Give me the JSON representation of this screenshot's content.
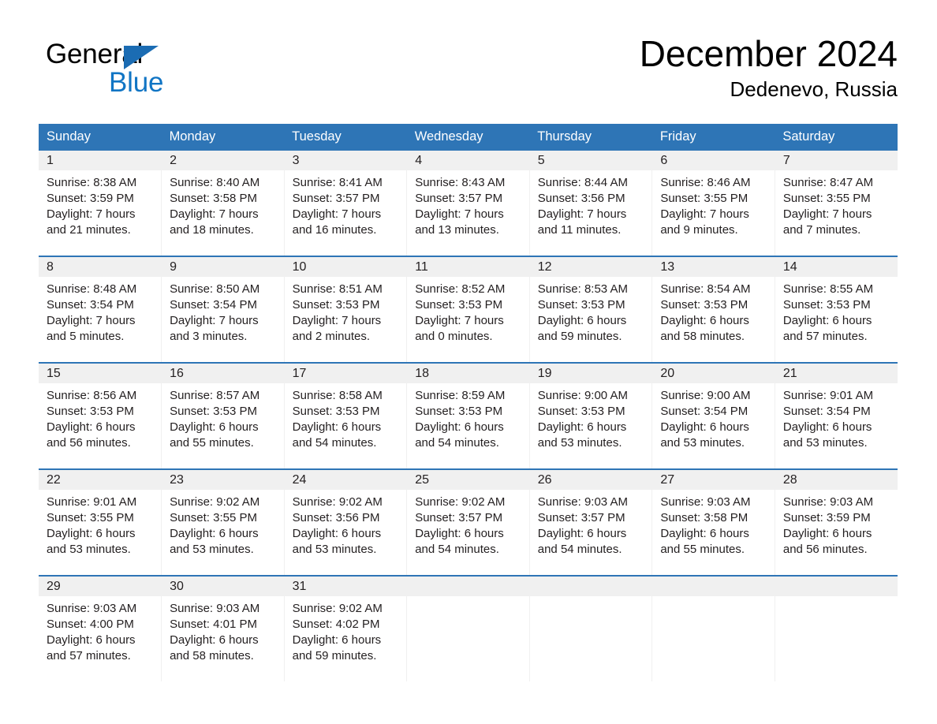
{
  "brand": {
    "name_part1": "General",
    "name_part2": "Blue",
    "triangle_color": "#1b6cb3",
    "blue_text_color": "#1175c4"
  },
  "header": {
    "month_title": "December 2024",
    "location": "Dedenevo, Russia"
  },
  "theme": {
    "header_blue": "#2e75b6",
    "row_divider_blue": "#2e75b6",
    "daynum_band": "#f0f0f0",
    "text": "#231f20"
  },
  "weekday_headers": [
    "Sunday",
    "Monday",
    "Tuesday",
    "Wednesday",
    "Thursday",
    "Friday",
    "Saturday"
  ],
  "weeks": [
    [
      {
        "day": "1",
        "sunrise": "Sunrise: 8:38 AM",
        "sunset": "Sunset: 3:59 PM",
        "daylight_line1": "Daylight: 7 hours",
        "daylight_line2": "and 21 minutes."
      },
      {
        "day": "2",
        "sunrise": "Sunrise: 8:40 AM",
        "sunset": "Sunset: 3:58 PM",
        "daylight_line1": "Daylight: 7 hours",
        "daylight_line2": "and 18 minutes."
      },
      {
        "day": "3",
        "sunrise": "Sunrise: 8:41 AM",
        "sunset": "Sunset: 3:57 PM",
        "daylight_line1": "Daylight: 7 hours",
        "daylight_line2": "and 16 minutes."
      },
      {
        "day": "4",
        "sunrise": "Sunrise: 8:43 AM",
        "sunset": "Sunset: 3:57 PM",
        "daylight_line1": "Daylight: 7 hours",
        "daylight_line2": "and 13 minutes."
      },
      {
        "day": "5",
        "sunrise": "Sunrise: 8:44 AM",
        "sunset": "Sunset: 3:56 PM",
        "daylight_line1": "Daylight: 7 hours",
        "daylight_line2": "and 11 minutes."
      },
      {
        "day": "6",
        "sunrise": "Sunrise: 8:46 AM",
        "sunset": "Sunset: 3:55 PM",
        "daylight_line1": "Daylight: 7 hours",
        "daylight_line2": "and 9 minutes."
      },
      {
        "day": "7",
        "sunrise": "Sunrise: 8:47 AM",
        "sunset": "Sunset: 3:55 PM",
        "daylight_line1": "Daylight: 7 hours",
        "daylight_line2": "and 7 minutes."
      }
    ],
    [
      {
        "day": "8",
        "sunrise": "Sunrise: 8:48 AM",
        "sunset": "Sunset: 3:54 PM",
        "daylight_line1": "Daylight: 7 hours",
        "daylight_line2": "and 5 minutes."
      },
      {
        "day": "9",
        "sunrise": "Sunrise: 8:50 AM",
        "sunset": "Sunset: 3:54 PM",
        "daylight_line1": "Daylight: 7 hours",
        "daylight_line2": "and 3 minutes."
      },
      {
        "day": "10",
        "sunrise": "Sunrise: 8:51 AM",
        "sunset": "Sunset: 3:53 PM",
        "daylight_line1": "Daylight: 7 hours",
        "daylight_line2": "and 2 minutes."
      },
      {
        "day": "11",
        "sunrise": "Sunrise: 8:52 AM",
        "sunset": "Sunset: 3:53 PM",
        "daylight_line1": "Daylight: 7 hours",
        "daylight_line2": "and 0 minutes."
      },
      {
        "day": "12",
        "sunrise": "Sunrise: 8:53 AM",
        "sunset": "Sunset: 3:53 PM",
        "daylight_line1": "Daylight: 6 hours",
        "daylight_line2": "and 59 minutes."
      },
      {
        "day": "13",
        "sunrise": "Sunrise: 8:54 AM",
        "sunset": "Sunset: 3:53 PM",
        "daylight_line1": "Daylight: 6 hours",
        "daylight_line2": "and 58 minutes."
      },
      {
        "day": "14",
        "sunrise": "Sunrise: 8:55 AM",
        "sunset": "Sunset: 3:53 PM",
        "daylight_line1": "Daylight: 6 hours",
        "daylight_line2": "and 57 minutes."
      }
    ],
    [
      {
        "day": "15",
        "sunrise": "Sunrise: 8:56 AM",
        "sunset": "Sunset: 3:53 PM",
        "daylight_line1": "Daylight: 6 hours",
        "daylight_line2": "and 56 minutes."
      },
      {
        "day": "16",
        "sunrise": "Sunrise: 8:57 AM",
        "sunset": "Sunset: 3:53 PM",
        "daylight_line1": "Daylight: 6 hours",
        "daylight_line2": "and 55 minutes."
      },
      {
        "day": "17",
        "sunrise": "Sunrise: 8:58 AM",
        "sunset": "Sunset: 3:53 PM",
        "daylight_line1": "Daylight: 6 hours",
        "daylight_line2": "and 54 minutes."
      },
      {
        "day": "18",
        "sunrise": "Sunrise: 8:59 AM",
        "sunset": "Sunset: 3:53 PM",
        "daylight_line1": "Daylight: 6 hours",
        "daylight_line2": "and 54 minutes."
      },
      {
        "day": "19",
        "sunrise": "Sunrise: 9:00 AM",
        "sunset": "Sunset: 3:53 PM",
        "daylight_line1": "Daylight: 6 hours",
        "daylight_line2": "and 53 minutes."
      },
      {
        "day": "20",
        "sunrise": "Sunrise: 9:00 AM",
        "sunset": "Sunset: 3:54 PM",
        "daylight_line1": "Daylight: 6 hours",
        "daylight_line2": "and 53 minutes."
      },
      {
        "day": "21",
        "sunrise": "Sunrise: 9:01 AM",
        "sunset": "Sunset: 3:54 PM",
        "daylight_line1": "Daylight: 6 hours",
        "daylight_line2": "and 53 minutes."
      }
    ],
    [
      {
        "day": "22",
        "sunrise": "Sunrise: 9:01 AM",
        "sunset": "Sunset: 3:55 PM",
        "daylight_line1": "Daylight: 6 hours",
        "daylight_line2": "and 53 minutes."
      },
      {
        "day": "23",
        "sunrise": "Sunrise: 9:02 AM",
        "sunset": "Sunset: 3:55 PM",
        "daylight_line1": "Daylight: 6 hours",
        "daylight_line2": "and 53 minutes."
      },
      {
        "day": "24",
        "sunrise": "Sunrise: 9:02 AM",
        "sunset": "Sunset: 3:56 PM",
        "daylight_line1": "Daylight: 6 hours",
        "daylight_line2": "and 53 minutes."
      },
      {
        "day": "25",
        "sunrise": "Sunrise: 9:02 AM",
        "sunset": "Sunset: 3:57 PM",
        "daylight_line1": "Daylight: 6 hours",
        "daylight_line2": "and 54 minutes."
      },
      {
        "day": "26",
        "sunrise": "Sunrise: 9:03 AM",
        "sunset": "Sunset: 3:57 PM",
        "daylight_line1": "Daylight: 6 hours",
        "daylight_line2": "and 54 minutes."
      },
      {
        "day": "27",
        "sunrise": "Sunrise: 9:03 AM",
        "sunset": "Sunset: 3:58 PM",
        "daylight_line1": "Daylight: 6 hours",
        "daylight_line2": "and 55 minutes."
      },
      {
        "day": "28",
        "sunrise": "Sunrise: 9:03 AM",
        "sunset": "Sunset: 3:59 PM",
        "daylight_line1": "Daylight: 6 hours",
        "daylight_line2": "and 56 minutes."
      }
    ],
    [
      {
        "day": "29",
        "sunrise": "Sunrise: 9:03 AM",
        "sunset": "Sunset: 4:00 PM",
        "daylight_line1": "Daylight: 6 hours",
        "daylight_line2": "and 57 minutes."
      },
      {
        "day": "30",
        "sunrise": "Sunrise: 9:03 AM",
        "sunset": "Sunset: 4:01 PM",
        "daylight_line1": "Daylight: 6 hours",
        "daylight_line2": "and 58 minutes."
      },
      {
        "day": "31",
        "sunrise": "Sunrise: 9:02 AM",
        "sunset": "Sunset: 4:02 PM",
        "daylight_line1": "Daylight: 6 hours",
        "daylight_line2": "and 59 minutes."
      },
      {
        "day": "",
        "sunrise": "",
        "sunset": "",
        "daylight_line1": "",
        "daylight_line2": ""
      },
      {
        "day": "",
        "sunrise": "",
        "sunset": "",
        "daylight_line1": "",
        "daylight_line2": ""
      },
      {
        "day": "",
        "sunrise": "",
        "sunset": "",
        "daylight_line1": "",
        "daylight_line2": ""
      },
      {
        "day": "",
        "sunrise": "",
        "sunset": "",
        "daylight_line1": "",
        "daylight_line2": ""
      }
    ]
  ]
}
